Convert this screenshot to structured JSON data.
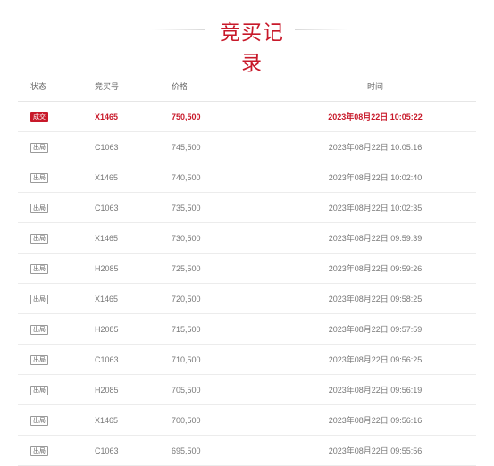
{
  "title": "竞买记录",
  "columns": [
    "状态",
    "竞买号",
    "价格",
    "时间"
  ],
  "records": [
    {
      "status": "成交",
      "bidder": "X1465",
      "price": "750,500",
      "time": "2023年08月22日 10:05:22",
      "won": true
    },
    {
      "status": "出局",
      "bidder": "C1063",
      "price": "745,500",
      "time": "2023年08月22日 10:05:16",
      "won": false
    },
    {
      "status": "出局",
      "bidder": "X1465",
      "price": "740,500",
      "time": "2023年08月22日 10:02:40",
      "won": false
    },
    {
      "status": "出局",
      "bidder": "C1063",
      "price": "735,500",
      "time": "2023年08月22日 10:02:35",
      "won": false
    },
    {
      "status": "出局",
      "bidder": "X1465",
      "price": "730,500",
      "time": "2023年08月22日 09:59:39",
      "won": false
    },
    {
      "status": "出局",
      "bidder": "H2085",
      "price": "725,500",
      "time": "2023年08月22日 09:59:26",
      "won": false
    },
    {
      "status": "出局",
      "bidder": "X1465",
      "price": "720,500",
      "time": "2023年08月22日 09:58:25",
      "won": false
    },
    {
      "status": "出局",
      "bidder": "H2085",
      "price": "715,500",
      "time": "2023年08月22日 09:57:59",
      "won": false
    },
    {
      "status": "出局",
      "bidder": "C1063",
      "price": "710,500",
      "time": "2023年08月22日 09:56:25",
      "won": false
    },
    {
      "status": "出局",
      "bidder": "H2085",
      "price": "705,500",
      "time": "2023年08月22日 09:56:19",
      "won": false
    },
    {
      "status": "出局",
      "bidder": "X1465",
      "price": "700,500",
      "time": "2023年08月22日 09:56:16",
      "won": false
    },
    {
      "status": "出局",
      "bidder": "C1063",
      "price": "695,500",
      "time": "2023年08月22日 09:55:56",
      "won": false
    }
  ],
  "colors": {
    "accent": "#c8192a",
    "text": "#777777"
  }
}
